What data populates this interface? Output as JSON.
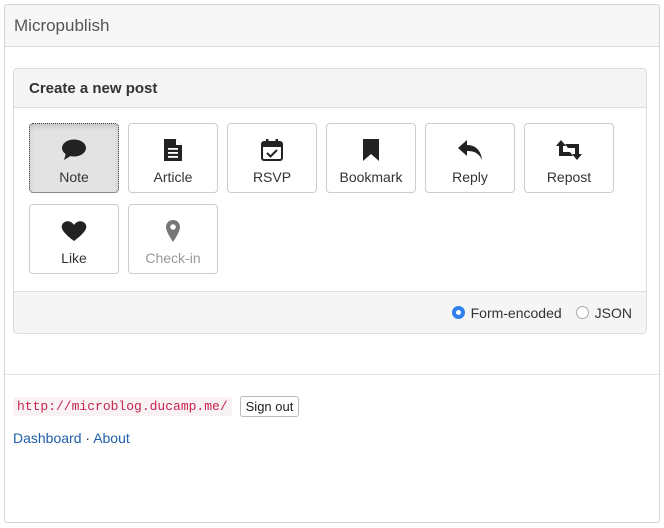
{
  "app": {
    "title": "Micropublish"
  },
  "panel": {
    "title": "Create a new post",
    "buttons": [
      {
        "label": "Note",
        "icon": "comment-icon",
        "state": "active"
      },
      {
        "label": "Article",
        "icon": "document-icon",
        "state": "normal"
      },
      {
        "label": "RSVP",
        "icon": "calendar-check-icon",
        "state": "normal"
      },
      {
        "label": "Bookmark",
        "icon": "bookmark-icon",
        "state": "normal"
      },
      {
        "label": "Reply",
        "icon": "reply-icon",
        "state": "normal"
      },
      {
        "label": "Repost",
        "icon": "retweet-icon",
        "state": "normal"
      },
      {
        "label": "Like",
        "icon": "heart-icon",
        "state": "normal"
      },
      {
        "label": "Check-in",
        "icon": "map-marker-icon",
        "state": "disabled"
      }
    ],
    "format": {
      "options": [
        {
          "label": "Form-encoded",
          "checked": true
        },
        {
          "label": "JSON",
          "checked": false
        }
      ]
    }
  },
  "footer": {
    "site_url": "http://microblog.ducamp.me/",
    "sign_out_label": "Sign out",
    "links": [
      {
        "label": "Dashboard"
      },
      {
        "label": "About"
      }
    ],
    "separator": "·"
  },
  "colors": {
    "accent": "#2f80ed",
    "link": "#1f5ea8",
    "code_text": "#c7254e",
    "code_bg": "#f9f2f4"
  }
}
